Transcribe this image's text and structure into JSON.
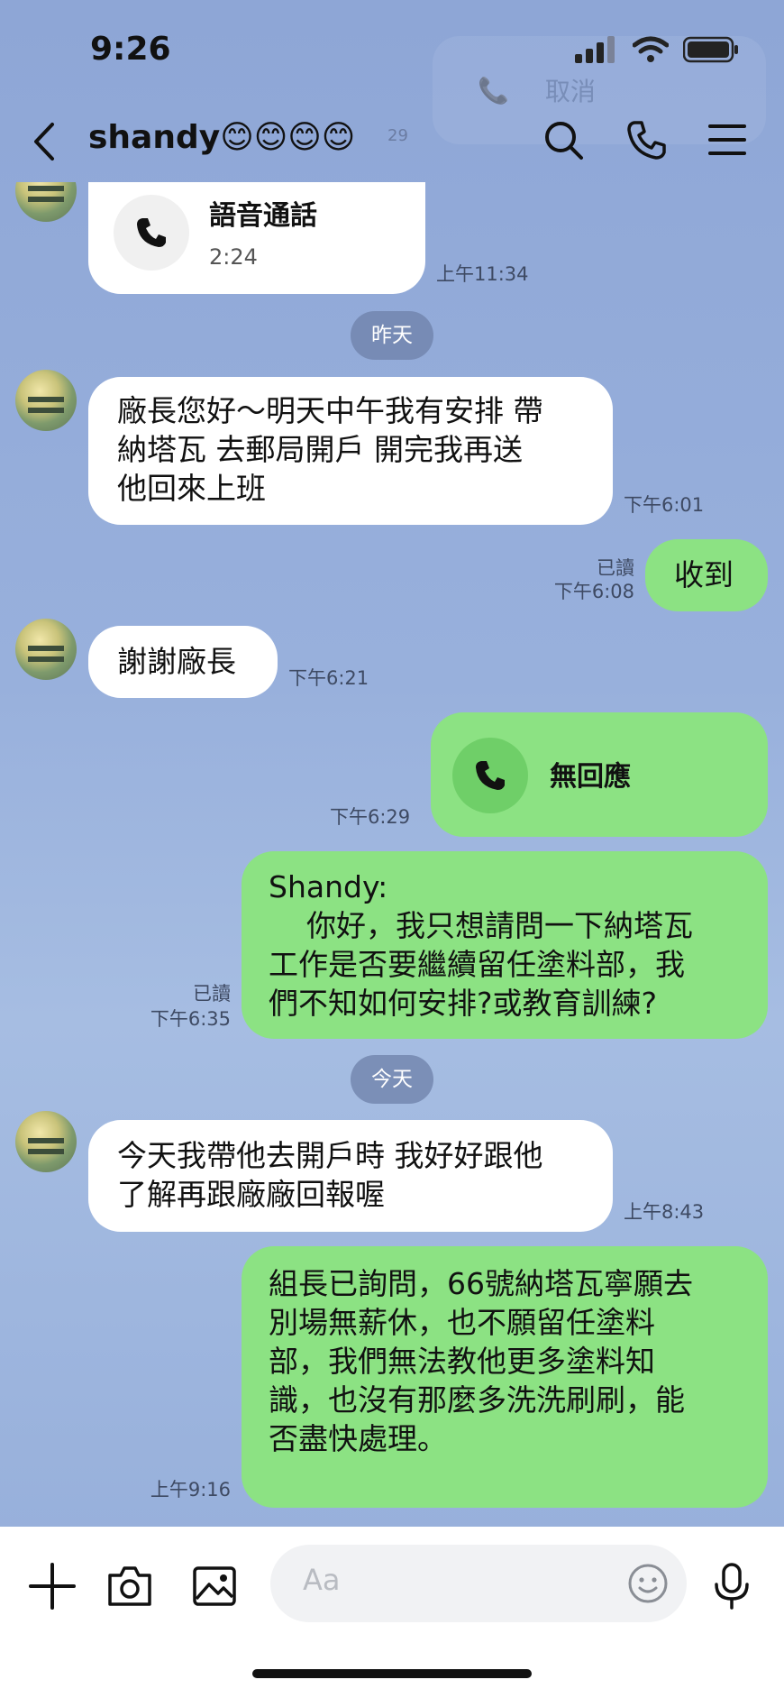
{
  "status_bar": {
    "time": "9:26"
  },
  "ghost_overlay": {
    "label": "取消",
    "time": "29"
  },
  "header": {
    "title": "shandy😊😊😊😊"
  },
  "messages": {
    "m1": {
      "title": "語音通話",
      "duration": "2:24",
      "time": "上午11:34"
    },
    "date1": "昨天",
    "m2": {
      "lines": [
        "廠長您好～明天中午我有安排 帶",
        "納塔瓦 去郵局開戶 開完我再送",
        "他回來上班"
      ],
      "time": "下午6:01"
    },
    "m3": {
      "text": "收到",
      "read": "已讀",
      "time": "下午6:08"
    },
    "m4": {
      "text": "謝謝廠長",
      "time": "下午6:21"
    },
    "m5": {
      "title": "無回應",
      "time": "下午6:29"
    },
    "m6": {
      "lines": [
        "Shandy:",
        "    你好，我只想請問一下納塔瓦",
        "工作是否要繼續留任塗料部，我",
        "們不知如何安排?或教育訓練?"
      ],
      "read": "已讀",
      "time": "下午6:35"
    },
    "date2": "今天",
    "m7": {
      "lines": [
        "今天我帶他去開戶時 我好好跟他",
        "了解再跟廠廠回報喔"
      ],
      "time": "上午8:43"
    },
    "m8": {
      "lines": [
        "組長已詢問，66號納塔瓦寧願去",
        "別場無薪休，也不願留任塗料",
        "部，我們無法教他更多塗料知",
        "識，也沒有那麼多洗洗刷刷，能",
        "否盡快處理。"
      ],
      "time": "上午9:16"
    }
  },
  "input": {
    "placeholder": "Aa"
  },
  "colors": {
    "outgoing": "#8ce283",
    "incoming": "#ffffff",
    "background": "#93acd9"
  }
}
